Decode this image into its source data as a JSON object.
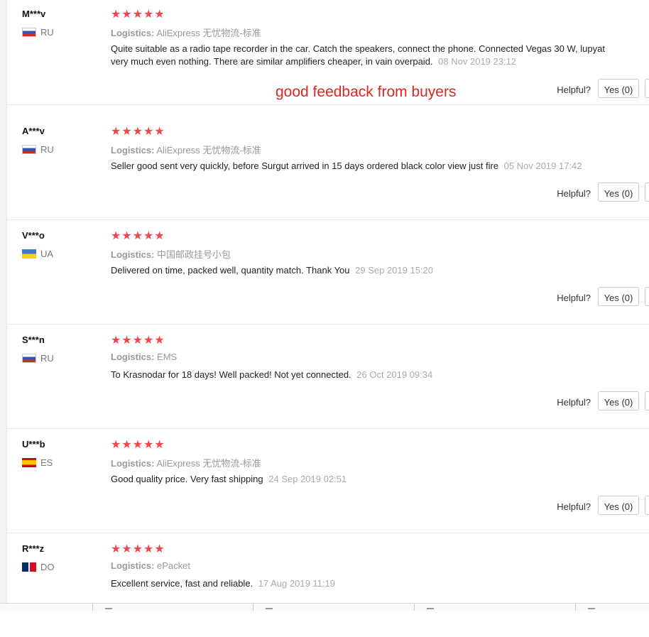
{
  "overlay": {
    "text": "good feedback from buyers"
  },
  "helpful_label": "Helpful?",
  "logistics_label": "Logistics:",
  "reviews": [
    {
      "user": "M***v",
      "country": "RU",
      "flag": "ru",
      "stars": "★★★★★",
      "rating": 5,
      "logistics": "AliExpress 无忧物流-标准",
      "text": "Quite suitable as a radio tape recorder in the car. Catch the speakers, connect the phone. Connected Vegas 30 W, lupyat very much even nothing. There are similar amplifiers cheaper, in vain overpaid.",
      "date": "08 Nov 2019 23:12",
      "yes": "Yes (0)"
    },
    {
      "user": "A***v",
      "country": "RU",
      "flag": "ru",
      "stars": "★★★★★",
      "rating": 5,
      "logistics": "AliExpress 无忧物流-标准",
      "text": "Seller good sent very quickly, before Surgut arrived in 15 days ordered black color view just fire",
      "date": "05 Nov 2019 17:42",
      "yes": "Yes (0)"
    },
    {
      "user": "V***o",
      "country": "UA",
      "flag": "ua",
      "stars": "★★★★★",
      "rating": 5,
      "logistics": "中国邮政挂号小包",
      "text": "Delivered on time, packed well, quantity match. Thank You",
      "date": "29 Sep 2019 15:20",
      "yes": "Yes (0)"
    },
    {
      "user": "S***n",
      "country": "RU",
      "flag": "ru",
      "stars": "★★★★★",
      "rating": 5,
      "logistics": "EMS",
      "text": "To Krasnodar for 18 days! Well packed! Not yet connected.",
      "date": "26 Oct 2019 09:34",
      "yes": "Yes (0)"
    },
    {
      "user": "U***b",
      "country": "ES",
      "flag": "es",
      "stars": "★★★★★",
      "rating": 5,
      "logistics": "AliExpress 无忧物流-标准",
      "text": "Good quality price. Very fast shipping",
      "date": "24 Sep 2019 02:51",
      "yes": "Yes (0)"
    },
    {
      "user": "R***z",
      "country": "DO",
      "flag": "do",
      "stars": "★★★★★",
      "rating": 5,
      "logistics": "ePacket",
      "text": "Excellent service, fast and reliable.",
      "date": "17 Aug 2019 11:19",
      "yes": ""
    }
  ]
}
